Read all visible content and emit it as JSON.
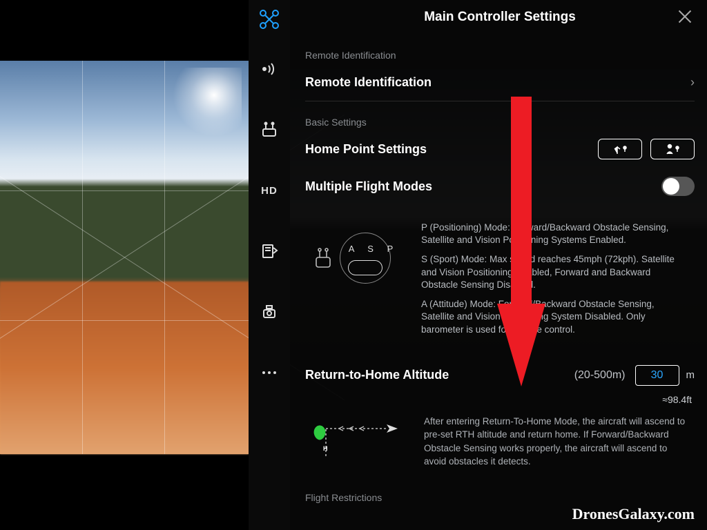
{
  "panel": {
    "title": "Main Controller Settings",
    "sections": {
      "remote_identification_header": "Remote Identification",
      "remote_identification_item": "Remote Identification",
      "basic_settings_header": "Basic Settings",
      "home_point_settings": "Home Point Settings",
      "multiple_flight_modes": "Multiple Flight Modes",
      "flight_restrictions_header": "Flight Restrictions"
    },
    "mode_switch_letters": "A S P",
    "mode_descriptions": {
      "p": "P (Positioning) Mode: Forward/Backward Obstacle Sensing, Satellite and Vision Positioning Systems Enabled.",
      "s": "S (Sport) Mode: Max speed reaches 45mph (72kph). Satellite and Vision Positioning Enabled, Forward and Backward Obstacle Sensing Disabled.",
      "a": "A (Attitude) Mode: Forward/Backward Obstacle Sensing, Satellite and Vision Positioning System Disabled. Only barometer is used for altitude control."
    },
    "rth": {
      "label": "Return-to-Home Altitude",
      "range": "(20-500m)",
      "value": "30",
      "unit": "m",
      "feet": "≈98.4ft",
      "description": "After entering Return-To-Home Mode, the aircraft will ascend to pre-set RTH altitude and return home. If Forward/Backward Obstacle Sensing works properly, the aircraft will ascend to avoid obstacles it detects."
    },
    "multiple_flight_modes_enabled": false
  },
  "iconcol": {
    "hd_label": "HD"
  },
  "watermark": "DronesGalaxy.com"
}
